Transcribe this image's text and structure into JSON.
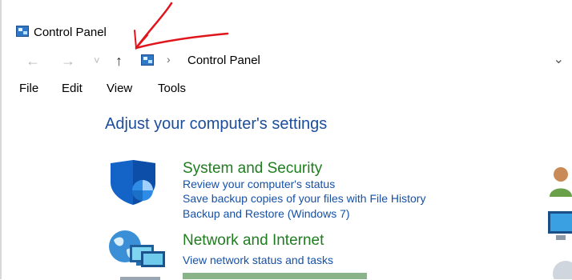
{
  "window": {
    "title": "Control Panel"
  },
  "navigation": {
    "back_glyph": "←",
    "forward_glyph": "→",
    "recent_glyph": "˅",
    "up_glyph": "↑",
    "breadcrumb_separator": "›",
    "breadcrumb": "Control Panel",
    "dropdown_glyph": "⌄"
  },
  "menu": {
    "items": [
      "File",
      "Edit",
      "View",
      "Tools"
    ]
  },
  "main": {
    "heading": "Adjust your computer's settings",
    "categories": [
      {
        "title": "System and Security",
        "icon": "shield-icon",
        "links": [
          "Review your computer's status",
          "Save backup copies of your files with File History",
          "Backup and Restore (Windows 7)"
        ]
      },
      {
        "title": "Network and Internet",
        "icon": "network-globe-icon",
        "links": [
          "View network status and tasks"
        ]
      }
    ]
  },
  "colors": {
    "heading": "#1c4e9c",
    "category_title": "#1f7d1f",
    "link": "#1551a8",
    "annotation": "#e0151b"
  }
}
